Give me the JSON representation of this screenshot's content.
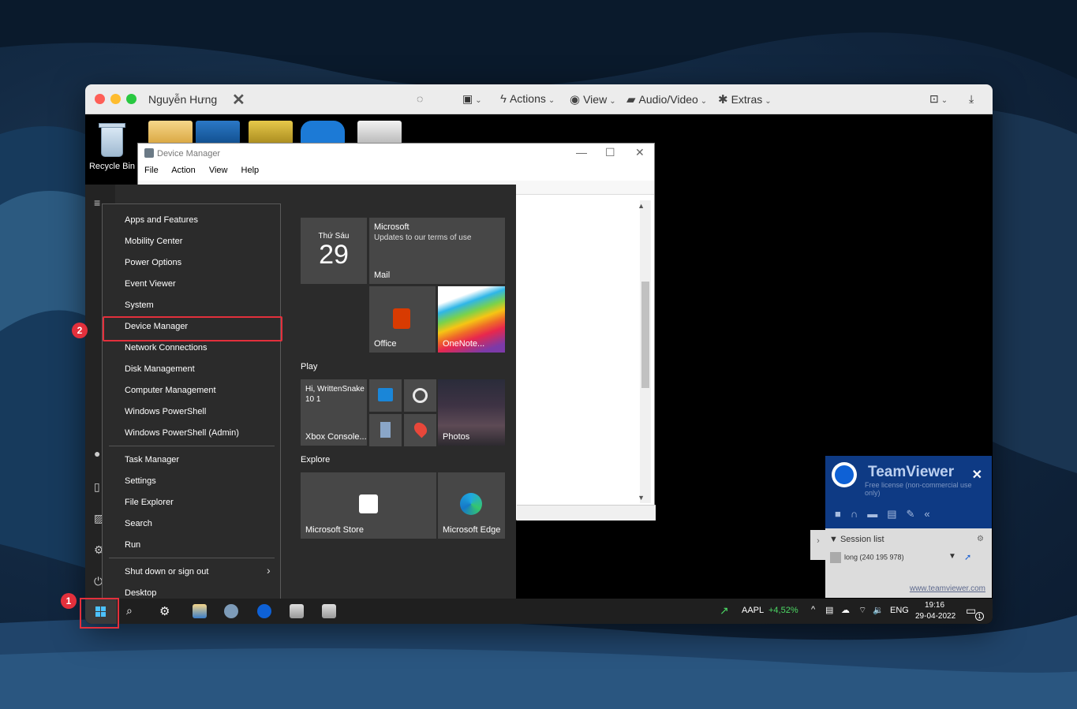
{
  "mac_window": {
    "title": "Nguyễn Hưng",
    "toolbar": {
      "actions": "Actions",
      "view": "View",
      "audio_video": "Audio/Video",
      "extras": "Extras"
    }
  },
  "desktop": {
    "recycle_bin": "Recycle Bin"
  },
  "device_manager": {
    "title": "Device Manager",
    "menu": [
      "File",
      "Action",
      "View",
      "Help"
    ]
  },
  "start_menu": {
    "sections": {
      "play": "Play",
      "explore": "Explore"
    },
    "tiles": {
      "calendar_day": "Thứ Sáu",
      "calendar_date": "29",
      "mail_from": "Microsoft",
      "mail_subject": "Updates to our terms of use",
      "mail_label": "Mail",
      "office": "Office",
      "onenote": "OneNote...",
      "xbox_greeting": "Hi, WrittenSnake10 1",
      "xbox_label": "Xbox Console...",
      "photos": "Photos",
      "store": "Microsoft Store",
      "edge": "Microsoft Edge"
    }
  },
  "context_menu": {
    "items": [
      "Apps and Features",
      "Mobility Center",
      "Power Options",
      "Event Viewer",
      "System",
      "Device Manager",
      "Network Connections",
      "Disk Management",
      "Computer Management",
      "Windows PowerShell",
      "Windows PowerShell (Admin)",
      "Task Manager",
      "Settings",
      "File Explorer",
      "Search",
      "Run",
      "Shut down or sign out",
      "Desktop"
    ],
    "highlighted": "Device Manager"
  },
  "taskbar": {
    "stock_symbol": "AAPL",
    "stock_change": "+4,52%",
    "language": "ENG",
    "time": "19:16",
    "date": "29-04-2022",
    "notification_count": "1"
  },
  "annotations": {
    "step1": "1",
    "step2": "2",
    "color": "#e3303c"
  },
  "teamviewer": {
    "name": "TeamViewer",
    "license": "Free license (non-commercial use only)",
    "session_list": "Session list",
    "session_entry": "long (240 195 978)",
    "link": "www.teamviewer.com"
  }
}
